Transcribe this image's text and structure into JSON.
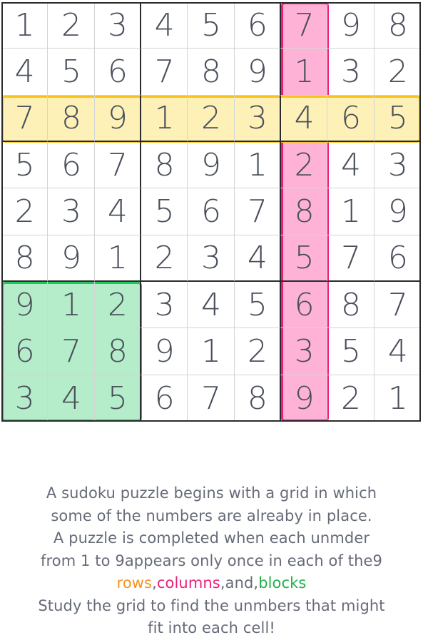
{
  "grid": {
    "rows": [
      [
        1,
        2,
        3,
        4,
        5,
        6,
        7,
        9,
        8
      ],
      [
        4,
        5,
        6,
        7,
        8,
        9,
        1,
        3,
        2
      ],
      [
        7,
        8,
        9,
        1,
        2,
        3,
        4,
        6,
        5
      ],
      [
        5,
        6,
        7,
        8,
        9,
        1,
        2,
        4,
        3
      ],
      [
        2,
        3,
        4,
        5,
        6,
        7,
        8,
        1,
        9
      ],
      [
        8,
        9,
        1,
        2,
        3,
        4,
        5,
        7,
        6
      ],
      [
        9,
        1,
        2,
        3,
        4,
        5,
        6,
        8,
        7
      ],
      [
        6,
        7,
        8,
        9,
        1,
        2,
        3,
        5,
        4
      ],
      [
        3,
        4,
        5,
        6,
        7,
        8,
        9,
        2,
        1
      ]
    ],
    "highlight_row": 3,
    "highlight_column": 7,
    "highlight_block": 7
  },
  "colors": {
    "row_fill": "#fdf1b8",
    "row_border": "#f9c21a",
    "column_fill": "#feb3d6",
    "column_border": "#ed1e79",
    "block_fill": "#b5ecc9",
    "block_border": "#22c55e",
    "rows_word": "#f7931e",
    "columns_word": "#ed1e79",
    "blocks_word": "#22b14c",
    "digit": "#4a4f5c",
    "caption_text": "#666b78"
  },
  "caption": {
    "line1": "A sudoku puzzle begins with a grid in which",
    "line2": "some of the numbers are alreaby in place.",
    "line3": "A puzzle is completed when each unmder",
    "line4": "from 1 to 9appears only once in each of the9",
    "word_rows": "rows",
    "sep1": ",",
    "word_columns": "columns",
    "sep2": ",and,",
    "word_blocks": "blocks",
    "line6": "Study the grid to find the unmbers that might",
    "line7": "fit into each cell!"
  }
}
